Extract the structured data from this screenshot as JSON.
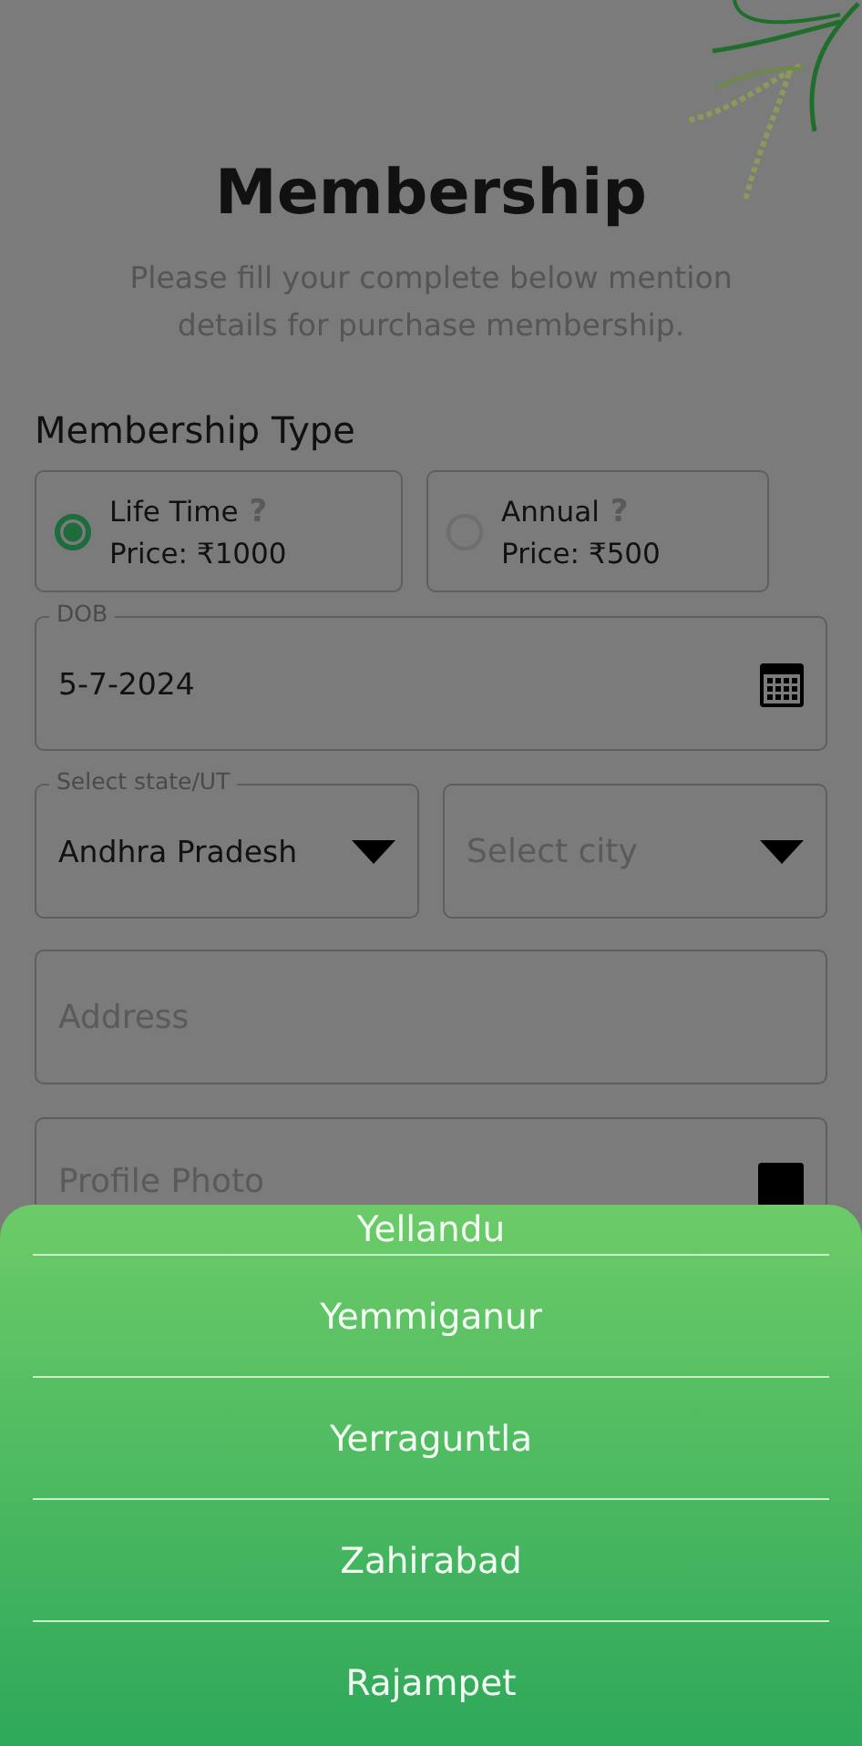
{
  "header": {
    "title": "Membership",
    "subtitle": "Please fill your complete below mention details for purchase membership."
  },
  "membership_type": {
    "label": "Membership Type",
    "options": [
      {
        "name": "Life Time",
        "help": "?",
        "price": "Price: ₹1000",
        "selected": true
      },
      {
        "name": "Annual",
        "help": "?",
        "price": "Price: ₹500",
        "selected": false
      }
    ]
  },
  "dob": {
    "label": "DOB",
    "value": "5-7-2024"
  },
  "state": {
    "label": "Select state/UT",
    "value": "Andhra Pradesh"
  },
  "city": {
    "placeholder": "Select city"
  },
  "address": {
    "placeholder": "Address"
  },
  "profile_photo": {
    "placeholder": "Profile Photo"
  },
  "city_sheet": {
    "items": [
      "Yellandu",
      "Yemmiganur",
      "Yerraguntla",
      "Zahirabad",
      "Rajampet"
    ]
  }
}
